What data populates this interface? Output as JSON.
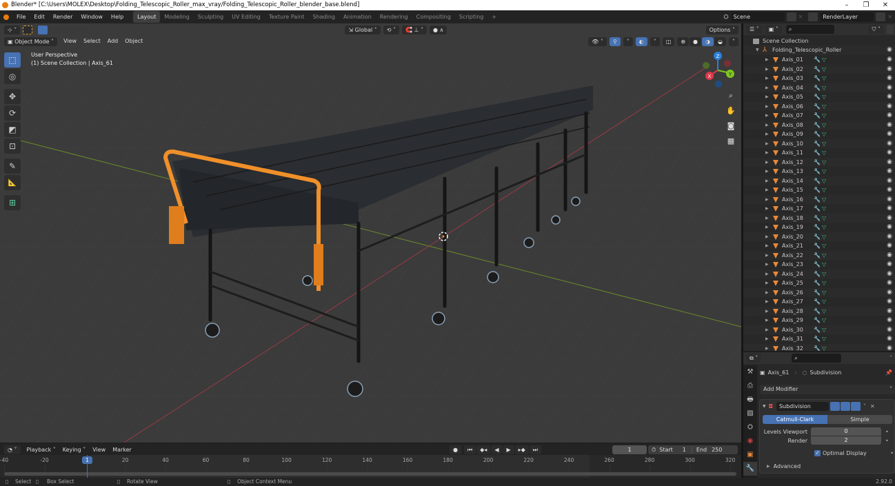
{
  "window": {
    "title": "Blender* [C:\\Users\\MOLEX\\Desktop\\Folding_Telescopic_Roller_max_vray/Folding_Telescopic_Roller_blender_base.blend]",
    "minimize": "–",
    "maximize": "❐",
    "close": "✕"
  },
  "menus": [
    "File",
    "Edit",
    "Render",
    "Window",
    "Help"
  ],
  "workspaces": [
    {
      "label": "Layout",
      "active": true
    },
    {
      "label": "Modeling"
    },
    {
      "label": "Sculpting"
    },
    {
      "label": "UV Editing"
    },
    {
      "label": "Texture Paint"
    },
    {
      "label": "Shading"
    },
    {
      "label": "Animation"
    },
    {
      "label": "Rendering"
    },
    {
      "label": "Compositing"
    },
    {
      "label": "Scripting"
    }
  ],
  "add_workspace": "+",
  "scene": {
    "label": "Scene",
    "render_layer": "RenderLayer"
  },
  "viewport": {
    "mode": "Object Mode",
    "menu": [
      "View",
      "Select",
      "Add",
      "Object"
    ],
    "transform_orientation": "Global",
    "options": "Options",
    "info_line1": "User Perspective",
    "info_line2": "(1) Scene Collection | Axis_61",
    "gizmo": {
      "x": "X",
      "y": "Y",
      "z": "Z",
      "x_color": "#e0384a",
      "y_color": "#7ec71e",
      "z_color": "#2a7fdc"
    },
    "tools": [
      {
        "name": "select-box",
        "glyph": "⬚",
        "active": true
      },
      {
        "name": "cursor",
        "glyph": "◎"
      },
      {
        "name": "move",
        "glyph": "✥"
      },
      {
        "name": "rotate",
        "glyph": "⟳"
      },
      {
        "name": "scale",
        "glyph": "◩"
      },
      {
        "name": "transform",
        "glyph": "⊡"
      },
      {
        "name": "annotate",
        "glyph": "✎"
      },
      {
        "name": "measure",
        "glyph": "📐"
      },
      {
        "name": "add-cube",
        "glyph": "⊞"
      }
    ],
    "nav": [
      {
        "name": "zoom",
        "glyph": "🔍"
      },
      {
        "name": "pan",
        "glyph": "✋"
      },
      {
        "name": "camera",
        "glyph": "🎥"
      },
      {
        "name": "ortho",
        "glyph": "▦"
      }
    ]
  },
  "outliner": {
    "root": "Scene Collection",
    "collection": "Folding_Telescopic_Roller",
    "items": [
      "Axis_01",
      "Axis_02",
      "Axis_03",
      "Axis_04",
      "Axis_05",
      "Axis_06",
      "Axis_07",
      "Axis_08",
      "Axis_09",
      "Axis_10",
      "Axis_11",
      "Axis_12",
      "Axis_13",
      "Axis_14",
      "Axis_15",
      "Axis_16",
      "Axis_17",
      "Axis_18",
      "Axis_19",
      "Axis_20",
      "Axis_21",
      "Axis_22",
      "Axis_23",
      "Axis_24",
      "Axis_25",
      "Axis_26",
      "Axis_27",
      "Axis_28",
      "Axis_29",
      "Axis_30",
      "Axis_31",
      "Axis_32"
    ]
  },
  "properties": {
    "object": "Axis_61",
    "modifier_crumb": "Subdivision",
    "add_modifier": "Add Modifier",
    "modifier": {
      "name": "Subdivision",
      "type_options": [
        "Catmull-Clark",
        "Simple"
      ],
      "selected_type": "Catmull-Clark",
      "levels_viewport_label": "Levels Viewport",
      "levels_viewport": "0",
      "render_label": "Render",
      "render": "2",
      "optimal_display_label": "Optimal Display",
      "optimal_display": true,
      "advanced": "Advanced"
    }
  },
  "timeline": {
    "menu": [
      "Playback",
      "Keying",
      "View",
      "Marker"
    ],
    "current_frame": "1",
    "start_label": "Start",
    "start": "1",
    "end_label": "End",
    "end": "250",
    "ticks": [
      "-40",
      "-20",
      "1",
      "20",
      "40",
      "60",
      "80",
      "100",
      "120",
      "140",
      "160",
      "180",
      "200",
      "220",
      "240",
      "260",
      "280",
      "300",
      "320"
    ]
  },
  "statusbar": {
    "select": "Select",
    "box_select": "Box Select",
    "rotate_view": "Rotate View",
    "context_menu": "Object Context Menu",
    "version": "2.92.0"
  }
}
